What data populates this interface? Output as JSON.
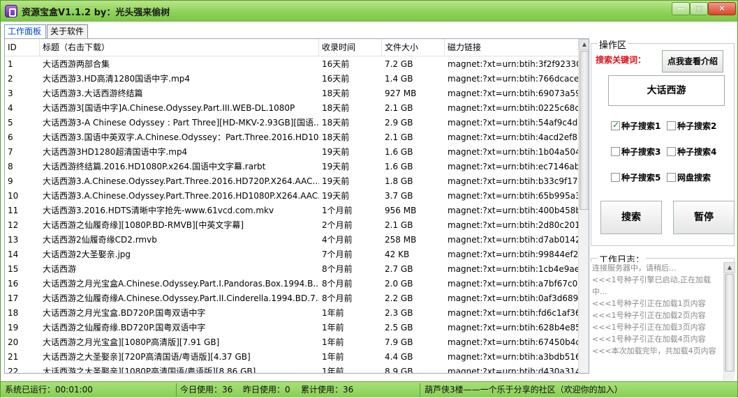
{
  "window": {
    "title": "资源宝盒V1.1.2 by：光头强来偷树",
    "min_glyph": "—",
    "max_glyph": "□",
    "close_glyph": "✕"
  },
  "tabs": [
    {
      "label": "工作面板"
    },
    {
      "label": "关于软件"
    }
  ],
  "table": {
    "headers": [
      "ID",
      "标题（右击下载）",
      "收录时间",
      "文件大小",
      "磁力链接"
    ],
    "rows": [
      [
        "1",
        "大话西游两部合集",
        "16天前",
        "7.2 GB",
        "magnet:?xt=urn:btih:3f2f923305."
      ],
      [
        "2",
        "大话西游3.HD高清1280国语中字.mp4",
        "16天前",
        "1.4 GB",
        "magnet:?xt=urn:btih:766dcaced9"
      ],
      [
        "3",
        "大话西游3.大话西游终结篇",
        "18天前",
        "927 MB",
        "magnet:?xt=urn:btih:69073a59e7"
      ],
      [
        "4",
        "大话西游3[国语中字]A.Chinese.Odyssey.Part.III.WEB-DL.1080P",
        "18天前",
        "2.1 GB",
        "magnet:?xt=urn:btih:0225c68d7."
      ],
      [
        "5",
        "大话西游3-A Chinese Odyssey : Part Three][HD-MKV-2.93GB][国语...",
        "18天前",
        "2.9 GB",
        "magnet:?xt=urn:btih:54af9c4d2c"
      ],
      [
        "6",
        "大话西游3.国语中英双字.A.Chinese.Odyssey：Part.Three.2016.HD10...",
        "18天前",
        "2.1 GB",
        "magnet:?xt=urn:btih:4acd2ef859"
      ],
      [
        "7",
        "大话西游3HD1280超清国语中字.mp4",
        "19天前",
        "1.6 GB",
        "magnet:?xt=urn:btih:1b04a5049."
      ],
      [
        "8",
        "大话西游终结篇.2016.HD1080P.x264.国语中文字幕.rarbt",
        "19天前",
        "1.6 GB",
        "magnet:?xt=urn:btih:ec7146ab55"
      ],
      [
        "9",
        "大话西游3.A.Chinese.Odyssey.Part.Three.2016.HD720P.X264.AAC....",
        "19天前",
        "1.8 GB",
        "magnet:?xt=urn:btih:b33c9f17c2"
      ],
      [
        "10",
        "大话西游3.A.Chinese.Odyssey.Part.Three.2016.HD1080P.X264.AAC....",
        "19天前",
        "3.7 GB",
        "magnet:?xt=urn:btih:65b995a3d."
      ],
      [
        "11",
        "大话西游3.2016.HDTS清晰中字抢先-www.61vcd.com.mkv",
        "1个月前",
        "956 MB",
        "magnet:?xt=urn:btih:400b458b4."
      ],
      [
        "12",
        "大话西游之仙履奇缘][1080P.BD-RMVB][中英文字幕]",
        "2个月前",
        "2.1 GB",
        "magnet:?xt=urn:btih:2d80c20108"
      ],
      [
        "13",
        "大话西游2仙履奇缘CD2.rmvb",
        "4个月前",
        "258 MB",
        "magnet:?xt=urn:btih:d7ab01427."
      ],
      [
        "14",
        "大话西游2大圣娶亲.jpg",
        "7个月前",
        "42 KB",
        "magnet:?xt=urn:btih:99844ef202"
      ],
      [
        "15",
        "大话西游",
        "8个月前",
        "2.7 GB",
        "magnet:?xt=urn:btih:1cb4e9ae75"
      ],
      [
        "16",
        "大话西游之月光宝盒A.Chinese.Odyssey.Part.I.Pandoras.Box.1994.B...",
        "8个月前",
        "2.0 GB",
        "magnet:?xt=urn:btih:a7bf67c05b"
      ],
      [
        "17",
        "大话西游之仙履奇缘A.Chinese.Odyssey.Part.II.Cinderella.1994.BD.7...",
        "8个月前",
        "2.2 GB",
        "magnet:?xt=urn:btih:0af3d68992"
      ],
      [
        "18",
        "大话西游之月光宝盒.BD720P.国粤双语中字",
        "1年前",
        "2.3 GB",
        "magnet:?xt=urn:btih:fd6c1af364."
      ],
      [
        "19",
        "大话西游之仙履奇缘.BD720P.国粤双语中字",
        "1年前",
        "2.5 GB",
        "magnet:?xt=urn:btih:628b4e85d."
      ],
      [
        "20",
        "大话西游之月光宝盒][1080P高清版][7.91 GB]",
        "1年前",
        "7.9 GB",
        "magnet:?xt=urn:btih:67450b4ce4"
      ],
      [
        "21",
        "大话西游之大圣娶亲][720P高清国语/粤语版][4.37 GB]",
        "1年前",
        "4.4 GB",
        "magnet:?xt=urn:btih:a3bdb5168"
      ],
      [
        "22",
        "大话西游之大圣娶亲][1080P高清国语/粤语版][8.86 GB]",
        "1年前",
        "8.9 GB",
        "magnet:?xt=urn:btih:d430a3144"
      ]
    ]
  },
  "panel": {
    "group_title": "操作区",
    "keyword_label": "搜索关键词：",
    "intro_button": "点我查看介绍",
    "keyword_value": "大话西游",
    "checkboxes": [
      {
        "label": "种子搜索1",
        "checked": true
      },
      {
        "label": "种子搜索2",
        "checked": false
      },
      {
        "label": "种子搜索3",
        "checked": false
      },
      {
        "label": "种子搜索4",
        "checked": false
      },
      {
        "label": "种子搜索5",
        "checked": false
      },
      {
        "label": "网盘搜索",
        "checked": false
      }
    ],
    "search_button": "搜索",
    "pause_button": "暂停"
  },
  "log": {
    "title": "工作日志：",
    "lines": [
      "连接服务器中，请稍后...",
      "<<<1号种子引擎已启动,正在加载中...",
      "<<<1号种子引正在加载1页内容",
      "<<<1号种子引正在加载2页内容",
      "<<<1号种子引正在加载3页内容",
      "<<<1号种子引正在加载4页内容",
      "<<<本次加载完毕，共加载4页内容"
    ]
  },
  "status": {
    "uptime": "系统已运行：00:01:00",
    "today": "今日使用：36",
    "yesterday": "昨日使用：0",
    "total": "累计使用：36",
    "slogan": "葫芦侠3楼——一个乐于分享的社区（欢迎你的加入）"
  }
}
